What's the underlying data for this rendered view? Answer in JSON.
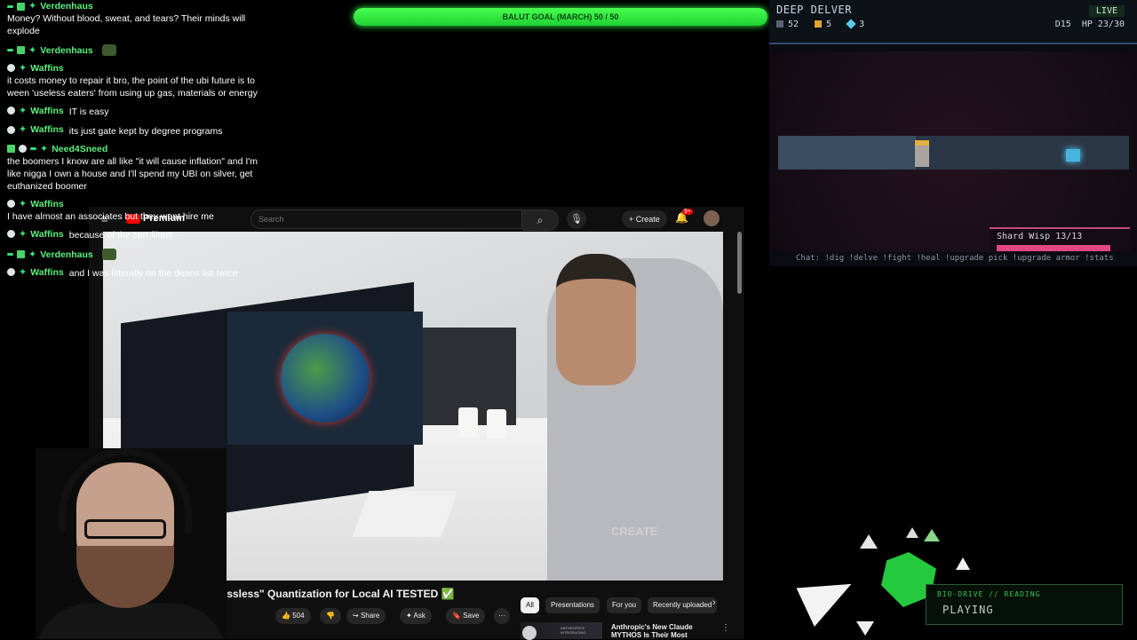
{
  "chat": {
    "messages": [
      {
        "user": "Verdenhaus",
        "text": "Money? Without blood, sweat, and tears? Their minds will explode",
        "inline": false,
        "badges": [
          "mod",
          "sub"
        ],
        "emote": false
      },
      {
        "user": "Verdenhaus",
        "text": "",
        "inline": true,
        "badges": [
          "mod",
          "sub"
        ],
        "emote": true
      },
      {
        "user": "Waffins",
        "text": "it costs money to repair it bro, the point of the ubi future is to ween 'useless eaters' from using up gas, materials or energy",
        "inline": false,
        "badges": [
          "circle"
        ],
        "emote": false
      },
      {
        "user": "Waffins",
        "text": "IT is easy",
        "inline": true,
        "badges": [
          "circle"
        ],
        "emote": false
      },
      {
        "user": "Waffins",
        "text": "its just gate kept by degree programs",
        "inline": true,
        "badges": [
          "circle"
        ],
        "emote": false
      },
      {
        "user": "Need4Sneed",
        "text": "the boomers I know are all like \"it will cause inflation\" and I'm like nigga I own a house and I'll spend my UBI on silver, get euthanized boomer",
        "inline": false,
        "badges": [
          "sq",
          "circle",
          "mod"
        ],
        "emote": false
      },
      {
        "user": "Waffins",
        "text": "I have almost an associates but they wont hire me",
        "inline": false,
        "badges": [
          "circle"
        ],
        "emote": false
      },
      {
        "user": "Waffins",
        "text": "because of the cert filters",
        "inline": true,
        "badges": [
          "circle"
        ],
        "emote": false
      },
      {
        "user": "Verdenhaus",
        "text": "",
        "inline": true,
        "badges": [
          "mod",
          "sub"
        ],
        "emote": true
      },
      {
        "user": "Waffins",
        "text": "and I was litterally on the deans list twice",
        "inline": true,
        "badges": [
          "circle"
        ],
        "emote": false
      }
    ]
  },
  "goal": {
    "label": "BALUT GOAL (MARCH) 50 / 50",
    "progress": 1.0
  },
  "game": {
    "title": "DEEP DELVER",
    "live": "LIVE",
    "stats": {
      "stone": "52",
      "gold": "5",
      "shards": "3"
    },
    "depth": "D15",
    "hp": "HP 23/30",
    "boss_name": "Shard Wisp 13/13",
    "boss_hp_fraction": 1.0,
    "commands": "Chat: !dig !delve !fight !heal !upgrade pick !upgrade armor !stats"
  },
  "youtube": {
    "menu_icon": "hamburger-icon",
    "logo": "Premium",
    "search_placeholder": "Search",
    "create": "Create",
    "notif_count": "9+",
    "video_title": "ossless\" Quantization for Local AI TESTED ✅",
    "watermark": "CREATE",
    "likes": "504",
    "share": "Share",
    "ask": "Ask",
    "save": "Save",
    "chips": [
      "All",
      "Presentations",
      "For you",
      "Recently uploaded"
    ],
    "rec_thumb_label": "ANTHROPIC'S INTRODUCING",
    "rec_title": "Anthropic's New Claude MYTHOS Is Their Most"
  },
  "bio": {
    "label": "BIO-DRIVE // READING",
    "status": "PLAYING"
  },
  "colors": {
    "accent_green": "#35e07a",
    "goal_green": "#47ff4f",
    "boss_bar": "#e34884"
  }
}
